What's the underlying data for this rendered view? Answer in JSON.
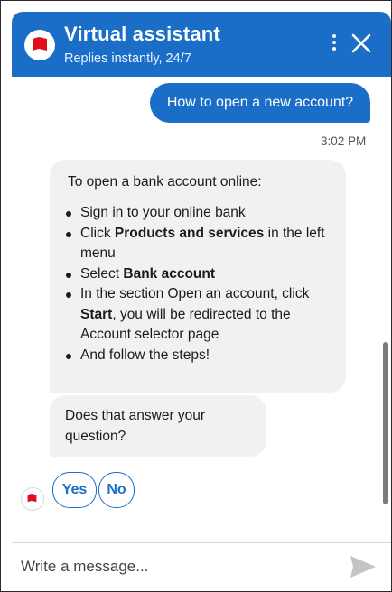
{
  "header": {
    "title": "Virtual assistant",
    "subtitle": "Replies instantly, 24/7",
    "logo_icon": "flag-logo-icon",
    "menu_icon": "more-vertical-icon",
    "close_icon": "close-icon",
    "color": "#1a6ec7"
  },
  "conversation": {
    "user_message": "How to open a new account?",
    "timestamp": "3:02 PM",
    "bot_answer": {
      "intro": "To open a bank account online:",
      "steps": [
        {
          "plain": "Sign in to your online bank"
        },
        {
          "pre": "Click ",
          "bold": "Products and services",
          "post": " in the left menu"
        },
        {
          "pre": "Select ",
          "bold": "Bank account"
        },
        {
          "pre": "In the section Open an account, click ",
          "bold": "Start",
          "post": ", you will be redirected to the Account selector page"
        },
        {
          "plain": "And follow the steps!"
        }
      ]
    },
    "bot_question": "Does that answer your question?",
    "quick_replies": [
      {
        "label": "Yes"
      },
      {
        "label": "No"
      }
    ],
    "bot_avatar_icon": "flag-avatar-icon"
  },
  "composer": {
    "placeholder": "Write a message...",
    "value": "",
    "send_icon": "send-icon"
  },
  "colors": {
    "accent": "#1a6ec7",
    "brand_flag": "#e0101a",
    "bubble_bot": "#f1f1f1"
  }
}
